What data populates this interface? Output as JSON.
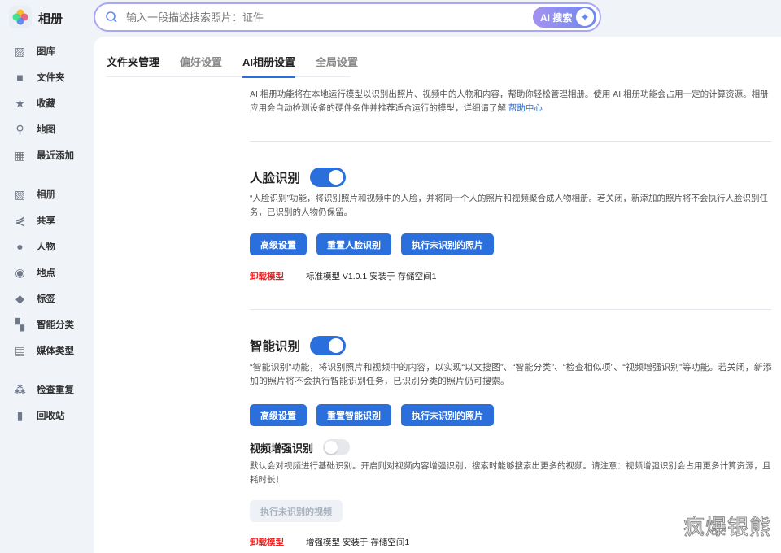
{
  "app": {
    "title": "相册"
  },
  "search": {
    "placeholder": "输入一段描述搜索照片：证件",
    "ai_button": "AI 搜索"
  },
  "sidebar": {
    "items": [
      {
        "label": "图库",
        "icon": "gallery-icon"
      },
      {
        "label": "文件夹",
        "icon": "folder-icon"
      },
      {
        "label": "收藏",
        "icon": "star-icon"
      },
      {
        "label": "地图",
        "icon": "map-icon"
      },
      {
        "label": "最近添加",
        "icon": "calendar-icon"
      },
      {
        "label": "相册",
        "icon": "album-icon"
      },
      {
        "label": "共享",
        "icon": "share-icon"
      },
      {
        "label": "人物",
        "icon": "person-icon"
      },
      {
        "label": "地点",
        "icon": "location-icon"
      },
      {
        "label": "标签",
        "icon": "tag-icon"
      },
      {
        "label": "智能分类",
        "icon": "grid-icon"
      },
      {
        "label": "媒体类型",
        "icon": "film-icon"
      },
      {
        "label": "检查重复",
        "icon": "duplicate-icon"
      },
      {
        "label": "回收站",
        "icon": "trash-icon"
      }
    ]
  },
  "tabs": [
    "文件夹管理",
    "偏好设置",
    "AI相册设置",
    "全局设置"
  ],
  "intro": {
    "text": "AI 相册功能将在本地运行模型以识别出照片、视频中的人物和内容，帮助你轻松管理相册。使用 AI 相册功能会占用一定的计算资源。相册应用会自动检测设备的硬件条件并推荐适合运行的模型，详细请了解 ",
    "link": "帮助中心"
  },
  "face": {
    "title": "人脸识别",
    "enabled": true,
    "desc": "“人脸识别”功能，将识别照片和视频中的人脸，并将同一个人的照片和视频聚合成人物相册。若关闭，新添加的照片将不会执行人脸识别任务，已识别的人物仍保留。",
    "buttons": [
      "高级设置",
      "重置人脸识别",
      "执行未识别的照片"
    ],
    "uninstall": "卸载模型",
    "model": "标准模型 V1.0.1 安装于 存储空间1"
  },
  "smart": {
    "title": "智能识别",
    "enabled": true,
    "desc": "“智能识别”功能，将识别照片和视频中的内容，以实现“以文搜图”、“智能分类”、“检查相似项”、“视频增强识别”等功能。若关闭，新添加的照片将不会执行智能识别任务，已识别分类的照片仍可搜索。",
    "buttons": [
      "高级设置",
      "重置智能识别",
      "执行未识别的照片"
    ]
  },
  "video": {
    "title": "视频增强识别",
    "enabled": false,
    "desc": "默认会对视频进行基础识别。开启则对视频内容增强识别，搜索时能够搜索出更多的视频。请注意：视频增强识别会占用更多计算资源，且耗时长！",
    "button": "执行未识别的视频",
    "uninstall": "卸载模型",
    "model": "增强模型 安装于 存储空间1"
  },
  "watermark": "疯爆银熊"
}
